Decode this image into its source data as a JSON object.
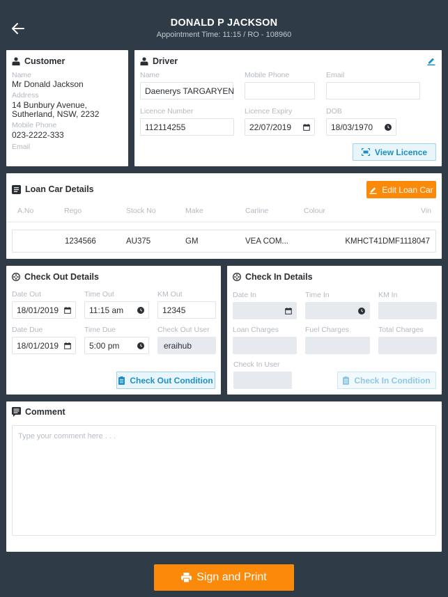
{
  "header": {
    "title": "DONALD P JACKSON",
    "subtitle": "Appointment Time: 11:15 / RO - 108960"
  },
  "customer": {
    "title": "Customer",
    "name_label": "Name",
    "name": "Mr Donald Jackson",
    "address_label": "Address",
    "address_line1": "14 Bunbury Avenue,",
    "address_line2": "Sutherland, NSW, 2232",
    "phone_label": "Mobile Phone",
    "phone": "023-2222-333",
    "email_label": "Email",
    "email": ""
  },
  "driver": {
    "title": "Driver",
    "name_label": "Name",
    "name": "Daenerys TARGARYEN",
    "phone_label": "Mobile Phone",
    "phone": "",
    "email_label": "Email",
    "email": "",
    "licence_number_label": "Licence Number",
    "licence_number": "112114255",
    "licence_expiry_label": "Licence Expiry",
    "licence_expiry": "22/07/2019",
    "dob_label": "DOB",
    "dob": "18/03/1970",
    "view_licence_label": "View Licence"
  },
  "loan_car": {
    "title": "Loan Car Details",
    "edit_label": "Edit Loan Car",
    "columns": [
      "A.No",
      "Rego",
      "Stock No",
      "Make",
      "Carline",
      "Colour",
      "Vin"
    ],
    "rows": [
      {
        "a_no": "",
        "rego": "1234566",
        "stock_no": "AU375",
        "make": "GM",
        "carline": "VEA COM...",
        "colour": "",
        "vin": "KMHCT41DMF1118047"
      }
    ]
  },
  "check_out": {
    "title": "Check Out Details",
    "date_out_label": "Date Out",
    "date_out": "18/01/2019",
    "time_out_label": "Time Out",
    "time_out": "11:15 am",
    "km_out_label": "KM Out",
    "km_out": "12345",
    "date_due_label": "Date Due",
    "date_due": "18/01/2019",
    "time_due_label": "Time Due",
    "time_due": "5:00 pm",
    "user_label": "Check Out User",
    "user": "eraihub",
    "condition_label": "Check Out Condition"
  },
  "check_in": {
    "title": "Check In Details",
    "date_in_label": "Date In",
    "date_in": "",
    "time_in_label": "Time In",
    "time_in": "",
    "km_in_label": "KM In",
    "km_in": "",
    "loan_charges_label": "Loan Charges",
    "fuel_charges_label": "Fuel Charges",
    "total_charges_label": "Total Charges",
    "user_label": "Check In User",
    "condition_label": "Check In Condition"
  },
  "comment": {
    "title": "Comment",
    "placeholder": "Type your comment here . . ."
  },
  "footer": {
    "sign_print_label": "Sign and Print"
  },
  "colors": {
    "background": "#2f3b46",
    "accent_orange": "#fb8a0b",
    "accent_blue": "#1c8fc6"
  }
}
